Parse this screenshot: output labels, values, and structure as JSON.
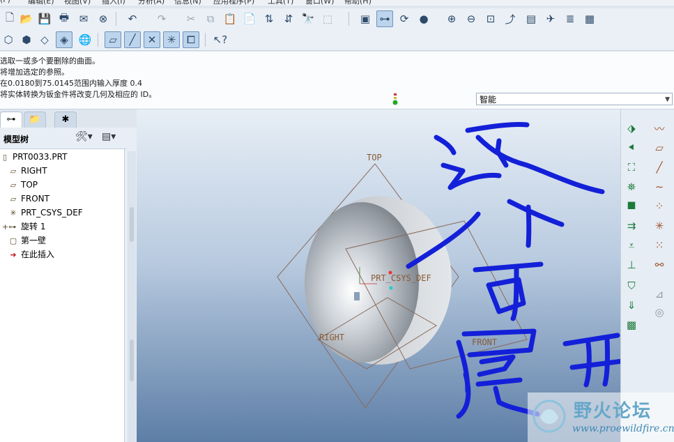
{
  "menubar": {
    "items": [
      "(F)",
      "编辑(E)",
      "视图(V)",
      "插入(I)",
      "分析(A)",
      "信息(N)",
      "应用程序(P)",
      "工具(T)",
      "窗口(W)",
      "帮助(H)"
    ]
  },
  "toolbar1": {
    "icons": [
      "new-file-icon",
      "open-folder-icon",
      "save-icon",
      "print-icon",
      "send-mail-icon",
      "close-window-icon",
      "undo-icon",
      "redo-icon",
      "cut-icon",
      "copy-icon",
      "paste-icon",
      "paste-special-icon",
      "regenerate-icon",
      "regen-manager-icon",
      "find-icon",
      "select-box-icon",
      "repaint-icon",
      "datum-toggle-icon",
      "spin-center-icon",
      "shading-icon",
      "zoom-in-icon",
      "zoom-out-icon",
      "refit-icon",
      "reorient-icon",
      "saved-views-icon",
      "view-manager-icon",
      "layers-icon",
      "appearance-icon"
    ]
  },
  "toolbar2": {
    "icons": [
      "wireframe-icon",
      "hidden-line-icon",
      "no-hidden-icon",
      "shading-mode-icon",
      "model-tree-icon",
      "datum-planes-icon",
      "datum-axes-icon",
      "datum-points-icon",
      "csys-icon",
      "annotations-icon",
      "context-help-icon"
    ]
  },
  "messages": {
    "lines": [
      "选取一或多个要删除的曲面。",
      "将增加选定的参照。",
      "在0.0180到75.0145范围内输入厚度  0.4",
      "将实体转换为钣金件将改变几何及相应的 ID。"
    ]
  },
  "filter": {
    "value": "智能"
  },
  "panel": {
    "tabs": [
      "model-tree-tab-icon",
      "layer-tab-icon",
      "favorites-tab-icon"
    ],
    "title": "模型树",
    "tree": [
      {
        "label": "PRT0033.PRT",
        "icon": "part-icon"
      },
      {
        "label": "RIGHT",
        "icon": "datum-plane-icon"
      },
      {
        "label": "TOP",
        "icon": "datum-plane-icon"
      },
      {
        "label": "FRONT",
        "icon": "datum-plane-icon"
      },
      {
        "label": "PRT_CSYS_DEF",
        "icon": "csys-icon"
      },
      {
        "label": "旋转 1",
        "icon": "revolve-icon"
      },
      {
        "label": "第一壁",
        "icon": "first-wall-icon"
      },
      {
        "label": "在此插入",
        "icon": "insert-here-arrow-icon"
      }
    ]
  },
  "viewport": {
    "datum_labels": {
      "top": "TOP",
      "right": "RIGHT",
      "front": "FRONT",
      "csys": "PRT_CSYS_DEF"
    },
    "handwritten_annotation": "这个可展开?",
    "annotation_color": "#1320d8"
  },
  "rightbar": {
    "icons": [
      "conversion-icon",
      "sketched-datum-curve-icon",
      "rip-icon",
      "datum-plane-tool-icon",
      "wall-icon",
      "datum-axis-icon",
      "flat-wall-icon",
      "datum-curve-icon",
      "flange-wall-icon",
      "datum-point-icon",
      "unbend-icon",
      "csys-tool-icon",
      "bend-back-icon",
      "analysis-icon",
      "extrude-cut-icon",
      "flat-pattern-icon",
      "punch-icon",
      "form-icon",
      "flatten-form-icon",
      "corner-relief-icon"
    ]
  },
  "watermark": {
    "brand": "野火论坛",
    "url": "www.proewildfire.cn"
  }
}
